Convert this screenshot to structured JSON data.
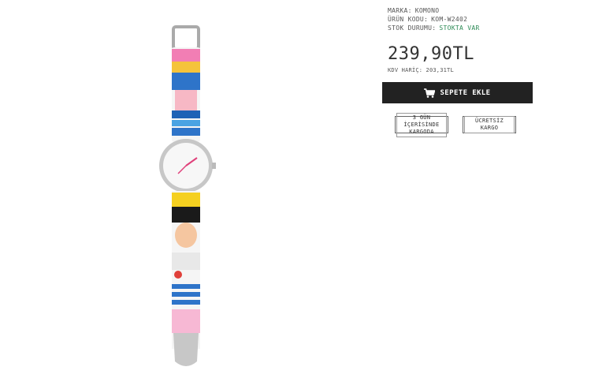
{
  "product": {
    "brand_label": "MARKA:",
    "brand_value": "KOMONO",
    "code_label": "ÜRÜN KODU:",
    "code_value": "KOM-W2402",
    "stock_label": "STOK DURUMU:",
    "stock_value": "STOKTA VAR",
    "price": "239,90TL",
    "price_excl_vat": "KDV HARİÇ: 203,31TL",
    "add_to_cart_label": "SEPETE EKLE",
    "badge_shipping_line1": "3 GÜN İÇERİSİNDE",
    "badge_shipping_line2": "KARGODA",
    "badge_free_shipping": "ÜCRETSİZ KARGO"
  },
  "colors": {
    "stock": "#2e8b57",
    "button_bg": "#222222",
    "hands": "#e0407a"
  },
  "icons": {
    "cart": "shopping-cart-icon"
  }
}
